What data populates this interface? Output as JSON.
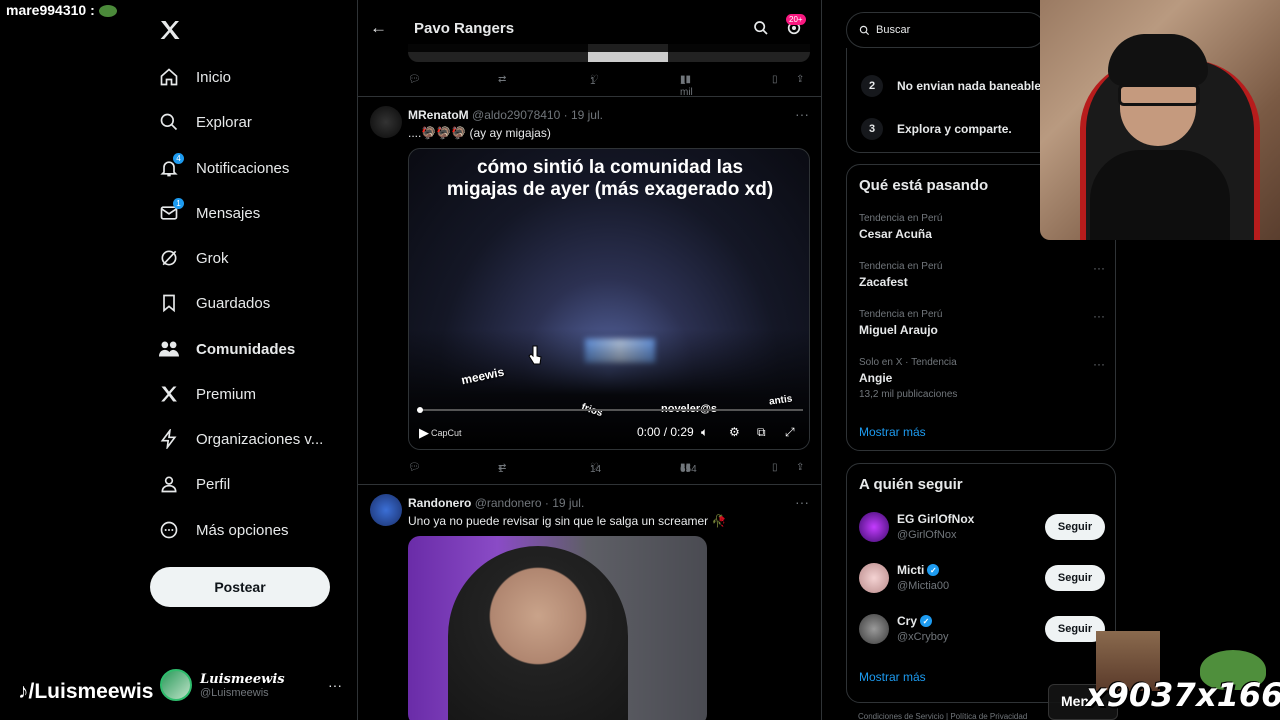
{
  "overlay": {
    "username": "mare994310 :"
  },
  "sidebar": {
    "items": [
      {
        "label": "Inicio",
        "icon": "home-icon"
      },
      {
        "label": "Explorar",
        "icon": "search-icon"
      },
      {
        "label": "Notificaciones",
        "icon": "bell-icon",
        "badge": "4"
      },
      {
        "label": "Mensajes",
        "icon": "mail-icon",
        "badge": "1"
      },
      {
        "label": "Grok",
        "icon": "grok-icon"
      },
      {
        "label": "Guardados",
        "icon": "bookmark-icon"
      },
      {
        "label": "Comunidades",
        "icon": "communities-icon"
      },
      {
        "label": "Premium",
        "icon": "x-icon"
      },
      {
        "label": "Organizaciones v...",
        "icon": "lightning-icon"
      },
      {
        "label": "Perfil",
        "icon": "person-icon"
      },
      {
        "label": "Más opciones",
        "icon": "more-circle-icon"
      }
    ],
    "post_label": "Postear",
    "profile": {
      "name": "Luismeewis",
      "handle": "@Luismeewis"
    }
  },
  "tiktok_label": "/Luismeewis",
  "header": {
    "title": "Pavo Rangers",
    "notif_count": "20+"
  },
  "top_tweet_actions": {
    "likes": "1",
    "views": "1 mil"
  },
  "tweets": [
    {
      "name": "MRenatoM",
      "handle": "@aldo29078410",
      "date": "· 19 jul.",
      "text": "....🦃🦃🦃 (ay ay migajas)",
      "video": {
        "caption_line1": "cómo sintió la comunidad las",
        "caption_line2": "migajas de ayer (más exagerado xd)",
        "stickers": [
          "meewis",
          "frios",
          "noveler@s",
          "antis",
          "CapCut"
        ],
        "time": "0:00 / 0:29",
        "progress": 0
      },
      "actions": {
        "retweets": "1",
        "likes": "14",
        "views": "654"
      }
    },
    {
      "name": "Randonero",
      "handle": "@randonero",
      "date": "· 19 jul.",
      "text": "Uno ya no puede revisar ig sin que le salga un screamer 🥀"
    }
  ],
  "search": {
    "placeholder": "Buscar"
  },
  "rules": [
    {
      "num": "2",
      "text": "No envian nada baneable."
    },
    {
      "num": "3",
      "text": "Explora y comparte."
    }
  ],
  "trends": {
    "title": "Qué está pasando",
    "items": [
      {
        "context": "Tendencia en Perú",
        "name": "Cesar Acuña"
      },
      {
        "context": "Tendencia en Perú",
        "name": "Zacafest"
      },
      {
        "context": "Tendencia en Perú",
        "name": "Miguel Araujo"
      },
      {
        "context": "Solo en X · Tendencia",
        "name": "Angie",
        "count": "13,2 mil publicaciones"
      }
    ],
    "show_more": "Mostrar más"
  },
  "who_to_follow": {
    "title": "A quién seguir",
    "items": [
      {
        "name": "EG GirlOfNox",
        "handle": "@GirlOfNox",
        "verified": false
      },
      {
        "name": "Micti",
        "handle": "@Mictia00",
        "verified": true
      },
      {
        "name": "Cry",
        "handle": "@xCryboy",
        "verified": true
      }
    ],
    "follow_label": "Seguir",
    "show_more": "Mostrar más"
  },
  "footer": "Condiciones de Servicio  |  Política de Privacidad",
  "stream_overlay": {
    "men_label": "Men",
    "counter1": "x9037",
    "counter2": "x166"
  },
  "colors": {
    "accent": "#1d9bf0",
    "background": "#000000",
    "border": "#2f3336"
  }
}
